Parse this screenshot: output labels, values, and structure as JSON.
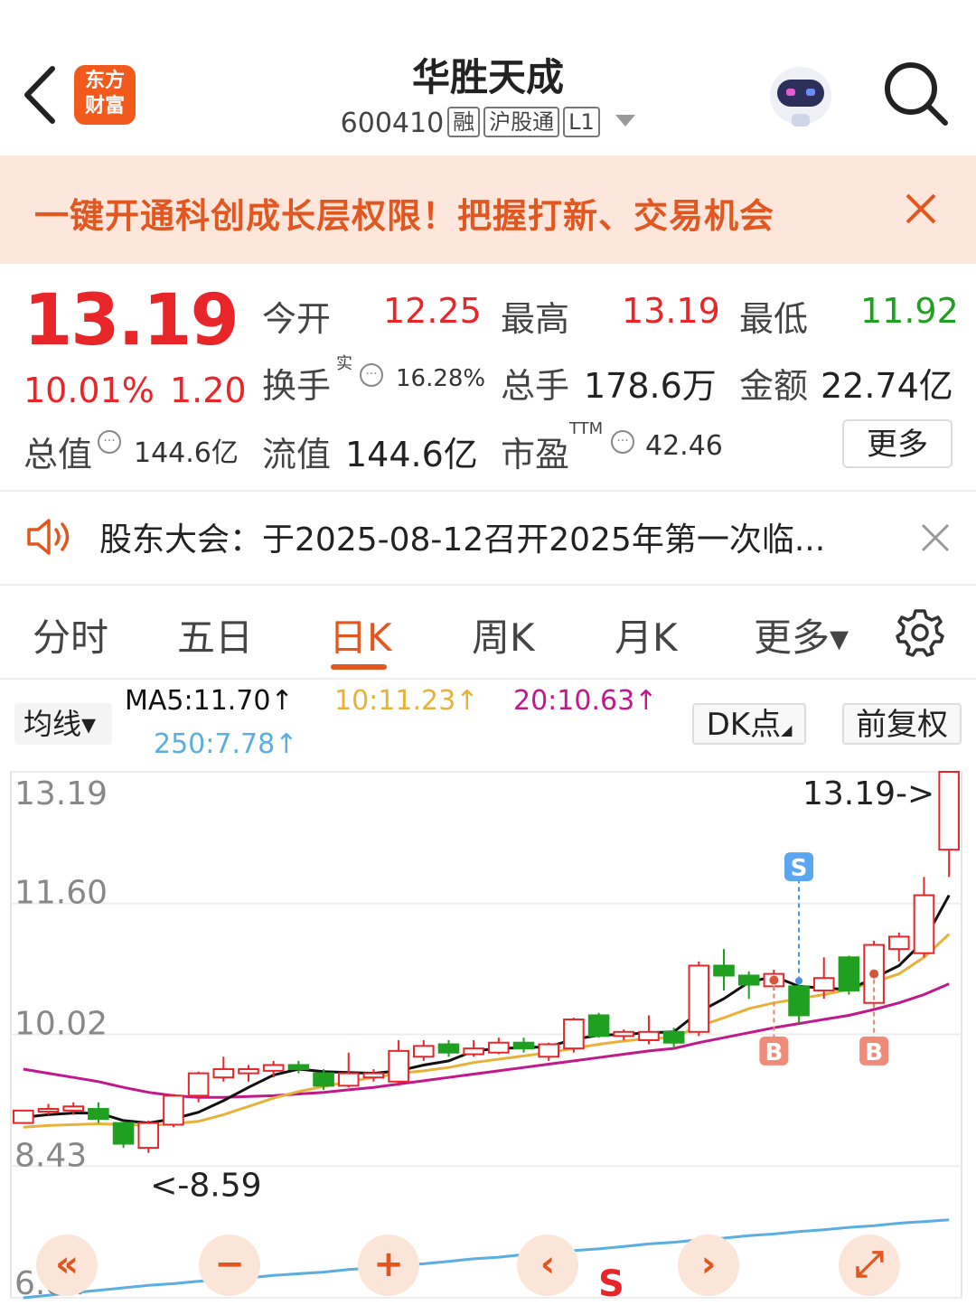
{
  "header": {
    "back_icon": "chevron-left-icon",
    "logo_line1": "东方",
    "logo_line2": "财富",
    "stock_name": "华胜天成",
    "stock_code": "600410",
    "tags": [
      "融",
      "沪股通",
      "L1"
    ],
    "robot_icon": "robot-avatar-icon",
    "search_icon": "search-icon"
  },
  "banner": {
    "text": "一键开通科创成长层权限！把握打新、交易机会",
    "close_icon": "close-icon",
    "bg_color": "#fde7dd",
    "text_color": "#e2561f"
  },
  "quote": {
    "price": "13.19",
    "change_pct": "10.01%",
    "change": "1.20",
    "open_label": "今开",
    "open": "12.25",
    "high_label": "最高",
    "high": "13.19",
    "low_label": "最低",
    "low": "11.92",
    "turnover_label": "换手",
    "turnover_sup": "实",
    "turnover": "16.28%",
    "volume_label": "总手",
    "volume": "178.6万",
    "amount_label": "金额",
    "amount": "22.74亿",
    "mktcap_label": "总值",
    "mktcap": "144.6亿",
    "float_label": "流值",
    "float_cap": "144.6亿",
    "pe_label": "市盈",
    "pe_sup": "TTM",
    "pe": "42.46",
    "more_label": "更多",
    "up_color": "#e8262a",
    "down_color": "#20a020"
  },
  "notice": {
    "icon": "speaker-icon",
    "text": "股东大会：于2025-08-12召开2025年第一次临...",
    "close_icon": "close-icon"
  },
  "tabs": [
    {
      "label": "分时"
    },
    {
      "label": "五日"
    },
    {
      "label": "日K"
    },
    {
      "label": "周K"
    },
    {
      "label": "月K"
    },
    {
      "label": "更多▾"
    }
  ],
  "settings_icon": "gear-icon",
  "ma_bar": {
    "select_label": "均线▾",
    "ma5": "MA5:11.70↑",
    "ma10": "10:11.23↑",
    "ma20": "20:10.63↑",
    "ma250": "250:7.78↑",
    "dk_label": "DK点",
    "adjust_label": "前复权",
    "ma5_color": "#111111",
    "ma10_color": "#e8b23a",
    "ma20_color": "#c2188b",
    "ma250_color": "#5aaee0"
  },
  "chart_data": {
    "type": "candlestick",
    "y_ticks": [
      "13.19",
      "11.60",
      "10.02",
      "8.43",
      "6.84"
    ],
    "ylim": [
      6.84,
      13.19
    ],
    "annotations": {
      "max_label": "13.19->",
      "min_label": "<-8.59",
      "signals": [
        {
          "label": "S",
          "candle_index": 31
        },
        {
          "label": "B",
          "candle_index": 30
        },
        {
          "label": "B",
          "candle_index": 34
        }
      ]
    },
    "candles": [
      {
        "o": 8.95,
        "c": 9.1,
        "h": 9.1,
        "l": 8.95,
        "up": true
      },
      {
        "o": 9.12,
        "c": 9.12,
        "h": 9.18,
        "l": 9.05,
        "up": true
      },
      {
        "o": 9.1,
        "c": 9.15,
        "h": 9.2,
        "l": 9.05,
        "up": true
      },
      {
        "o": 9.12,
        "c": 9.0,
        "h": 9.2,
        "l": 8.95,
        "up": false
      },
      {
        "o": 8.95,
        "c": 8.7,
        "h": 8.97,
        "l": 8.65,
        "up": false
      },
      {
        "o": 8.65,
        "c": 8.95,
        "h": 8.98,
        "l": 8.59,
        "up": true
      },
      {
        "o": 8.93,
        "c": 9.28,
        "h": 9.3,
        "l": 8.9,
        "up": true
      },
      {
        "o": 9.28,
        "c": 9.55,
        "h": 9.57,
        "l": 9.2,
        "up": true
      },
      {
        "o": 9.5,
        "c": 9.6,
        "h": 9.75,
        "l": 9.45,
        "up": true
      },
      {
        "o": 9.55,
        "c": 9.6,
        "h": 9.65,
        "l": 9.45,
        "up": true
      },
      {
        "o": 9.58,
        "c": 9.65,
        "h": 9.7,
        "l": 9.5,
        "up": true
      },
      {
        "o": 9.65,
        "c": 9.6,
        "h": 9.7,
        "l": 9.55,
        "up": false
      },
      {
        "o": 9.55,
        "c": 9.4,
        "h": 9.6,
        "l": 9.35,
        "up": false
      },
      {
        "o": 9.4,
        "c": 9.55,
        "h": 9.8,
        "l": 9.38,
        "up": true
      },
      {
        "o": 9.5,
        "c": 9.55,
        "h": 9.6,
        "l": 9.45,
        "up": true
      },
      {
        "o": 9.45,
        "c": 9.82,
        "h": 9.95,
        "l": 9.4,
        "up": true
      },
      {
        "o": 9.75,
        "c": 9.88,
        "h": 9.95,
        "l": 9.7,
        "up": true
      },
      {
        "o": 9.9,
        "c": 9.8,
        "h": 9.95,
        "l": 9.75,
        "up": false
      },
      {
        "o": 9.78,
        "c": 9.85,
        "h": 9.95,
        "l": 9.75,
        "up": true
      },
      {
        "o": 9.8,
        "c": 9.92,
        "h": 9.98,
        "l": 9.78,
        "up": true
      },
      {
        "o": 9.92,
        "c": 9.85,
        "h": 9.98,
        "l": 9.8,
        "up": false
      },
      {
        "o": 9.75,
        "c": 9.9,
        "h": 9.92,
        "l": 9.7,
        "up": true
      },
      {
        "o": 9.85,
        "c": 10.2,
        "h": 10.22,
        "l": 9.8,
        "up": true
      },
      {
        "o": 10.25,
        "c": 10.0,
        "h": 10.28,
        "l": 9.98,
        "up": false
      },
      {
        "o": 10.0,
        "c": 10.05,
        "h": 10.08,
        "l": 9.95,
        "up": true
      },
      {
        "o": 9.95,
        "c": 10.05,
        "h": 10.25,
        "l": 9.9,
        "up": true
      },
      {
        "o": 10.05,
        "c": 9.92,
        "h": 10.1,
        "l": 9.85,
        "up": false
      },
      {
        "o": 10.05,
        "c": 10.85,
        "h": 10.9,
        "l": 10.0,
        "up": true
      },
      {
        "o": 10.85,
        "c": 10.73,
        "h": 11.05,
        "l": 10.55,
        "up": false
      },
      {
        "o": 10.73,
        "c": 10.62,
        "h": 10.78,
        "l": 10.45,
        "up": false
      },
      {
        "o": 10.6,
        "c": 10.75,
        "h": 10.8,
        "l": 10.55,
        "up": true
      },
      {
        "o": 10.6,
        "c": 10.25,
        "h": 10.62,
        "l": 10.15,
        "up": false
      },
      {
        "o": 10.55,
        "c": 10.7,
        "h": 10.95,
        "l": 10.45,
        "up": true
      },
      {
        "o": 10.95,
        "c": 10.55,
        "h": 10.97,
        "l": 10.5,
        "up": false
      },
      {
        "o": 10.4,
        "c": 11.1,
        "h": 11.15,
        "l": 10.35,
        "up": true
      },
      {
        "o": 11.05,
        "c": 11.2,
        "h": 11.25,
        "l": 10.9,
        "up": true
      },
      {
        "o": 11.0,
        "c": 11.7,
        "h": 11.92,
        "l": 10.95,
        "up": true
      },
      {
        "o": 12.25,
        "c": 13.19,
        "h": 13.19,
        "l": 11.92,
        "up": true
      }
    ],
    "ma5": [
      9.02,
      9.05,
      9.07,
      9.07,
      8.98,
      8.95,
      9.0,
      9.08,
      9.22,
      9.38,
      9.53,
      9.6,
      9.57,
      9.56,
      9.55,
      9.58,
      9.65,
      9.7,
      9.82,
      9.85,
      9.86,
      9.87,
      9.96,
      10.01,
      10.02,
      10.04,
      10.05,
      10.29,
      10.45,
      10.65,
      10.72,
      10.6,
      10.58,
      10.56,
      10.7,
      10.85,
      11.15,
      11.7
    ],
    "ma10": [
      8.9,
      8.92,
      8.93,
      8.94,
      8.93,
      8.92,
      8.94,
      8.97,
      9.05,
      9.15,
      9.25,
      9.33,
      9.39,
      9.45,
      9.5,
      9.55,
      9.58,
      9.62,
      9.68,
      9.72,
      9.76,
      9.8,
      9.85,
      9.9,
      9.94,
      9.97,
      9.98,
      10.12,
      10.22,
      10.33,
      10.4,
      10.45,
      10.5,
      10.56,
      10.65,
      10.75,
      10.95,
      11.23
    ],
    "ma20": [
      9.6,
      9.55,
      9.5,
      9.45,
      9.38,
      9.32,
      9.28,
      9.26,
      9.26,
      9.27,
      9.28,
      9.3,
      9.32,
      9.35,
      9.38,
      9.42,
      9.46,
      9.5,
      9.54,
      9.58,
      9.62,
      9.66,
      9.7,
      9.74,
      9.78,
      9.82,
      9.85,
      9.92,
      9.98,
      10.04,
      10.1,
      10.15,
      10.2,
      10.25,
      10.32,
      10.4,
      10.5,
      10.63
    ],
    "ma250": [
      6.84,
      6.87,
      6.9,
      6.93,
      6.96,
      6.99,
      7.01,
      7.04,
      7.06,
      7.08,
      7.11,
      7.13,
      7.15,
      7.18,
      7.2,
      7.23,
      7.25,
      7.28,
      7.31,
      7.33,
      7.36,
      7.38,
      7.41,
      7.43,
      7.46,
      7.49,
      7.51,
      7.54,
      7.56,
      7.59,
      7.61,
      7.64,
      7.66,
      7.69,
      7.71,
      7.74,
      7.76,
      7.78
    ]
  },
  "chart_controls": [
    {
      "name": "scroll-left-fast-button",
      "glyph": "«"
    },
    {
      "name": "zoom-out-button",
      "glyph": "−"
    },
    {
      "name": "zoom-in-button",
      "glyph": "+"
    },
    {
      "name": "scroll-left-button",
      "glyph": "‹"
    },
    {
      "name": "scroll-right-button",
      "glyph": "›"
    },
    {
      "name": "fullscreen-button",
      "glyph": "⤢"
    }
  ],
  "bottom_signal": "S"
}
